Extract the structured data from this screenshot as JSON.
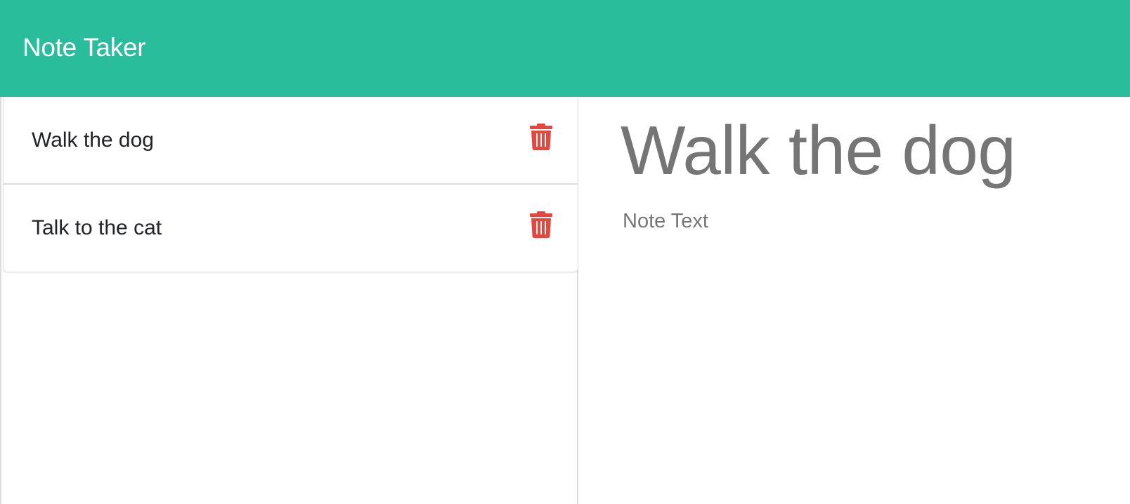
{
  "navbar": {
    "brand": "Note Taker",
    "background": "#2abd9c"
  },
  "notes": {
    "items": [
      {
        "title": "Walk the dog",
        "delete_icon": "trash-icon"
      },
      {
        "title": "Talk to the cat",
        "delete_icon": "trash-icon"
      }
    ],
    "delete_color": "#e5473f"
  },
  "editor": {
    "title_value": "Walk the dog",
    "text_placeholder": "Note Text",
    "text_value": ""
  }
}
